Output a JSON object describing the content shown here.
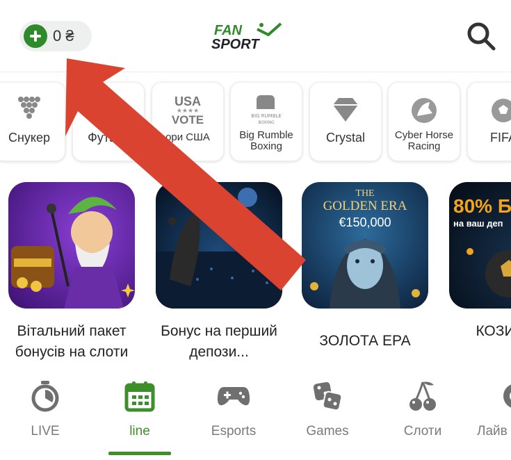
{
  "header": {
    "balance": "0 ₴",
    "logo_top": "FAN",
    "logo_bottom": "SPORT"
  },
  "categories": [
    {
      "label": "Снукер",
      "icon": "snooker-icon"
    },
    {
      "label": "Футзал",
      "icon": "futsal-icon"
    },
    {
      "label": "ори США",
      "icon": "usa-vote-icon",
      "badge_top": "USA",
      "badge_bottom": "VOTE"
    },
    {
      "label": "Big Rumble Boxing",
      "icon": "boxing-glove-icon",
      "badge": "BIG RUMBLE BOXING"
    },
    {
      "label": "Crystal",
      "icon": "diamond-icon"
    },
    {
      "label": "Cyber Horse Racing",
      "icon": "horse-icon"
    },
    {
      "label": "FIFA",
      "icon": "football-icon"
    }
  ],
  "promos": [
    {
      "caption": "Вітальний пакет бонусів на слоти"
    },
    {
      "caption": "Бонус на перший депози..."
    },
    {
      "caption": "ЗОЛОТА ЕРА",
      "banner_line1": "THE",
      "banner_line2": "GOLDEN ERA",
      "banner_line3": "€150,000"
    },
    {
      "caption": "КОЗИ СЕР",
      "banner_line1": "80% Б",
      "banner_line2": "на ваш деп"
    }
  ],
  "nav": [
    {
      "label": "LIVE",
      "icon": "stopwatch-icon"
    },
    {
      "label": "line",
      "icon": "calendar-icon",
      "active": true
    },
    {
      "label": "Esports",
      "icon": "gamepad-icon"
    },
    {
      "label": "Games",
      "icon": "dice-icon"
    },
    {
      "label": "Слоти",
      "icon": "cherries-icon"
    },
    {
      "label": "Лайв",
      "icon": "chip-icon"
    }
  ],
  "colors": {
    "brand_green": "#3f8e2c",
    "arrow_red": "#d9432f"
  }
}
